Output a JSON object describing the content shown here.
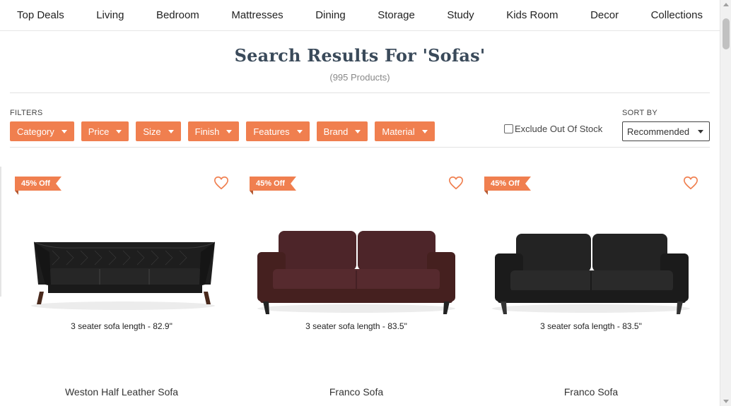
{
  "nav": {
    "items": [
      "Top Deals",
      "Living",
      "Bedroom",
      "Mattresses",
      "Dining",
      "Storage",
      "Study",
      "Kids Room",
      "Decor",
      "Collections"
    ]
  },
  "results": {
    "title": "Search Results For 'Sofas'",
    "count": "(995 Products)"
  },
  "filters": {
    "label": "FILTERS",
    "buttons": [
      "Category",
      "Price",
      "Size",
      "Finish",
      "Features",
      "Brand",
      "Material"
    ],
    "exclude_label": "Exclude Out Of Stock"
  },
  "sort": {
    "label": "SORT BY",
    "selected": "Recommended"
  },
  "products": [
    {
      "badge": "45% Off",
      "dimension": "3 seater sofa length - 82.9\"",
      "name": "Weston Half Leather Sofa",
      "color": "#1e1e1e"
    },
    {
      "badge": "45% Off",
      "dimension": "3 seater sofa length - 83.5\"",
      "name": "Franco Sofa",
      "color": "#4d2529"
    },
    {
      "badge": "45% Off",
      "dimension": "3 seater sofa length - 83.5\"",
      "name": "Franco Sofa",
      "color": "#232323"
    }
  ],
  "colors": {
    "accent": "#f07f4f",
    "title": "#3a4a5a"
  }
}
